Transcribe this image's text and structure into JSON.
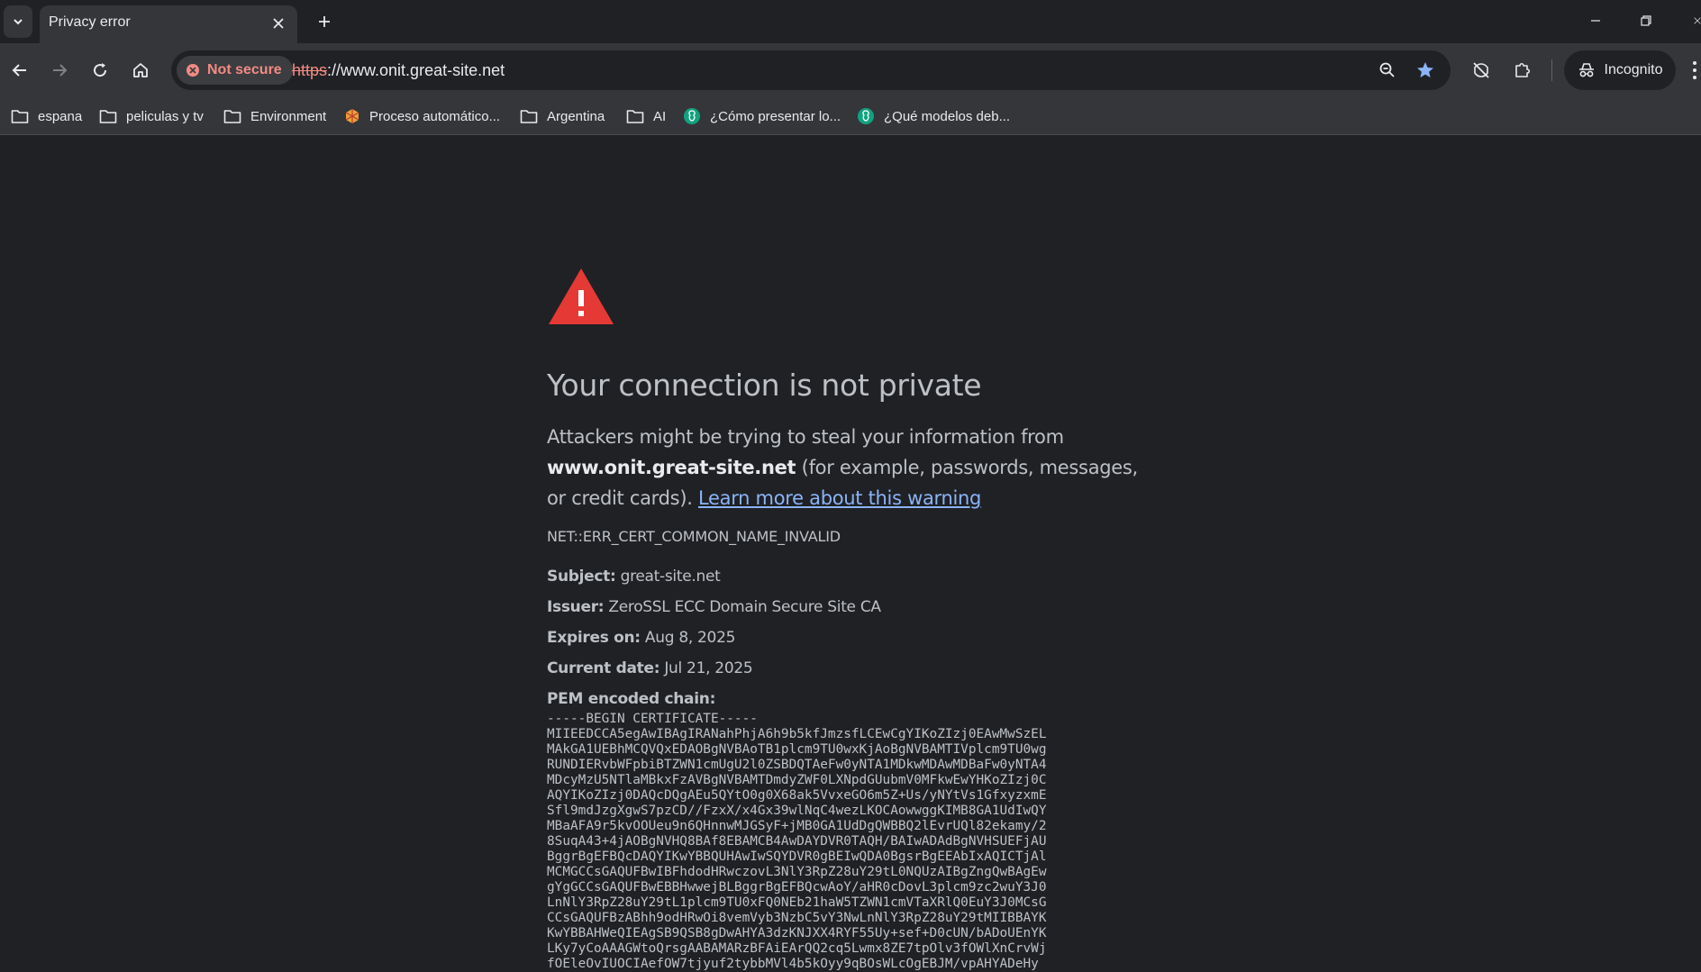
{
  "tab": {
    "title": "Privacy error"
  },
  "omnibox": {
    "security_label": "Not secure",
    "url_scheme": "https",
    "url_rest": "://www.onit.great-site.net"
  },
  "incognito_label": "Incognito",
  "bookmarks": [
    {
      "label": "espana",
      "icon": "folder-icon"
    },
    {
      "label": "peliculas y tv",
      "icon": "folder-icon"
    },
    {
      "label": "Environment",
      "icon": "folder-icon"
    },
    {
      "label": "Proceso automático...",
      "icon": "site-icon"
    },
    {
      "label": "Argentina",
      "icon": "folder-icon"
    },
    {
      "label": "AI",
      "icon": "folder-icon"
    },
    {
      "label": "¿Cómo presentar lo...",
      "icon": "chatgpt-icon"
    },
    {
      "label": "¿Qué modelos deb...",
      "icon": "chatgpt-icon"
    }
  ],
  "page": {
    "heading": "Your connection is not private",
    "explain_prefix": "Attackers might be trying to steal your information from",
    "explain_host": "www.onit.great-site.net",
    "explain_suffix": "(for example, passwords, messages, or credit cards).",
    "learn_more": "Learn more about this warning",
    "error_code": "NET::ERR_CERT_COMMON_NAME_INVALID",
    "details": [
      {
        "label": "Subject:",
        "value": "great-site.net"
      },
      {
        "label": "Issuer:",
        "value": "ZeroSSL ECC Domain Secure Site CA"
      },
      {
        "label": "Expires on:",
        "value": "Aug 8, 2025"
      },
      {
        "label": "Current date:",
        "value": "Jul 21, 2025"
      }
    ],
    "pem_label": "PEM encoded chain:",
    "pem_text": "-----BEGIN CERTIFICATE-----\nMIIEEDCCA5egAwIBAgIRANahPhjA6h9b5kfJmzsfLCEwCgYIKoZIzj0EAwMwSzEL\nMAkGA1UEBhMCQVQxEDAOBgNVBAoTB1plcm9TU0wxKjAoBgNVBAMTIVplcm9TU0wg\nRUNDIERvbWFpbiBTZWN1cmUgU2l0ZSBDQTAeFw0yNTA1MDkwMDAwMDBaFw0yNTA4\nMDcyMzU5NTlaMBkxFzAVBgNVBAMTDmdyZWF0LXNpdGUubmV0MFkwEwYHKoZIzj0C\nAQYIKoZIzj0DAQcDQgAEu5QYtO0g0X68ak5VvxeGO6m5Z+Us/yNYtVs1GfxyzxmE\nSfl9mdJzgXgwS7pzCD//FzxX/x4Gx39wlNqC4wezLKOCAowwggKIMB8GA1UdIwQY\nMBaAFA9r5kvOOUeu9n6QHnnwMJGSyF+jMB0GA1UdDgQWBBQ2lEvrUQl82ekamy/2\n8SuqA43+4jAOBgNVHQ8BAf8EBAMCB4AwDAYDVR0TAQH/BAIwADAdBgNVHSUEFjAU\nBggrBgEFBQcDAQYIKwYBBQUHAwIwSQYDVR0gBEIwQDA0BgsrBgEEAbIxAQICTjAl\nMCMGCCsGAQUFBwIBFhdodHRwczovL3NlY3RpZ28uY29tL0NQUzAIBgZngQwBAgEw\ngYgGCCsGAQUFBwEBBHwwejBLBggrBgEFBQcwAoY/aHR0cDovL3plcm9zc2wuY3J0\nLnNlY3RpZ28uY29tL1plcm9TU0xFQ0NEb21haW5TZWN1cmVTaXRlQ0EuY3J0MCsG\nCCsGAQUFBzABhh9odHRwOi8vemVyb3NzbC5vY3NwLnNlY3RpZ28uY29tMIIBBAYK\nKwYBBAHWeQIEAgSB9QSB8gDwAHYA3dzKNJXX4RYF55Uy+sef+D0cUN/bADoUEnYK\nLKy7yCoAAAGWtoQrsgAABAMARzBFAiEArQQ2cq5Lwmx8ZE7tpOlv3fOWlXnCrvWj\nfOEleOvIUOCIAefOW7tjyuf2tybbMVl4b5kOyy9qBOsWLcOgEBJM/vpAHYADeHy"
  }
}
